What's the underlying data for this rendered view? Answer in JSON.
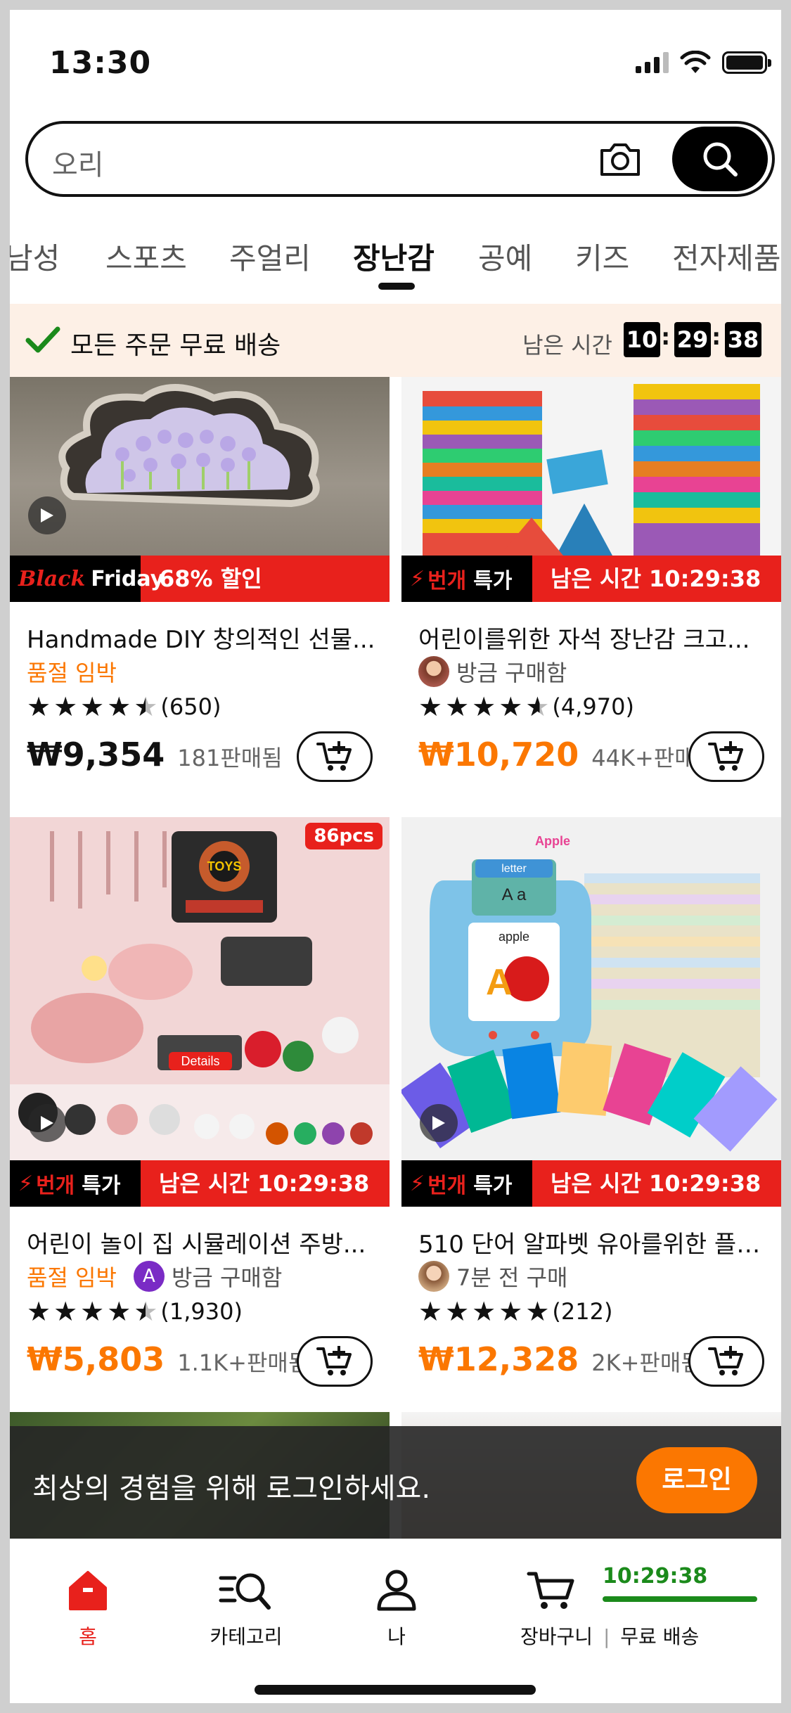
{
  "status_bar": {
    "time": "13:30"
  },
  "search": {
    "query": "오리"
  },
  "tabs": [
    {
      "label": "남성"
    },
    {
      "label": "스포츠"
    },
    {
      "label": "주얼리"
    },
    {
      "label": "장난감",
      "active": true
    },
    {
      "label": "공예"
    },
    {
      "label": "키즈"
    },
    {
      "label": "전자제품"
    }
  ],
  "shipping_banner": {
    "text": "모든 주문 무료 배송",
    "timer_label": "남은 시간",
    "hours": "10",
    "minutes": "29",
    "seconds": "38"
  },
  "products": [
    {
      "deal_left_a": "Black",
      "deal_left_b": "Friday",
      "deal_right": "68% 할인",
      "title": "Handmade DIY 창의적인 선물...",
      "tag": "품절 임박",
      "rating_count": "(650)",
      "stars": 4.5,
      "price": "₩9,354",
      "sold": "181판매됨"
    },
    {
      "deal_left_a": "번개",
      "deal_left_b": "특가",
      "deal_right": "남은 시간 10:29:38",
      "title": "어린이를위한 자석 장난감 크고...",
      "buyer_text": "방금 구매함",
      "rating_count": "(4,970)",
      "stars": 4.5,
      "price": "₩10,720",
      "sold": "44K+판매됨"
    },
    {
      "badge": "86pcs",
      "image_text_a": "TOYS",
      "image_text_b": "Details",
      "deal_left_a": "번개",
      "deal_left_b": "특가",
      "deal_right": "남은 시간 10:29:38",
      "title": "어린이 놀이 집 시뮬레이션 주방...",
      "tag": "품절 임박",
      "avatar_letter": "A",
      "buyer_text": "방금 구매함",
      "rating_count": "(1,930)",
      "stars": 4.5,
      "price": "₩5,803",
      "sold": "1.1K+판매됨"
    },
    {
      "image_text_a": "letter",
      "image_text_b": "A a",
      "image_text_c": "apple",
      "image_text_d": "Apple",
      "deal_left_a": "번개",
      "deal_left_b": "특가",
      "deal_right": "남은 시간 10:29:38",
      "title": "510 단어 알파벳 유아를위한 플래...",
      "buyer_text": "7분 전 구매",
      "rating_count": "(212)",
      "stars": 5,
      "price": "₩12,328",
      "sold": "2K+판매됨"
    }
  ],
  "login_prompt": {
    "text": "최상의 경험을 위해 로그인하세요.",
    "button": "로그인"
  },
  "bottom_nav": {
    "home": "홈",
    "category": "카테고리",
    "me": "나",
    "cart": "장바구니",
    "free_shipping": "무료 배송",
    "timer": "10:29:38"
  },
  "colors": {
    "accent": "#fb7701",
    "deal_red": "#e8211c",
    "timer_green": "#1b8a1b"
  }
}
